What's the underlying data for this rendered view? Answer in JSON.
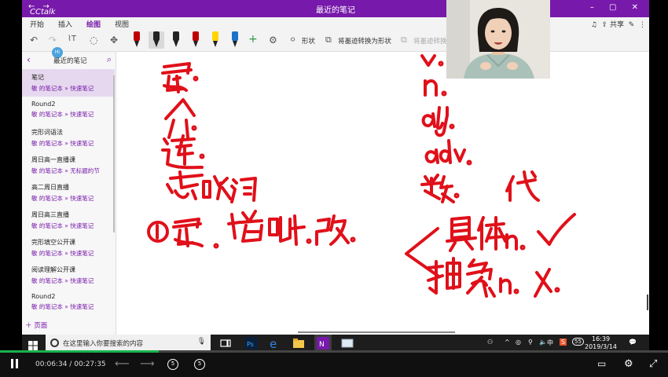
{
  "window": {
    "title": "最近的笔记",
    "app_brand": "CCtalk",
    "nav_back": "←",
    "nav_forward": "→",
    "win_controls": "–  ▢  ✕"
  },
  "menu": {
    "items": [
      "开始",
      "插入",
      "绘图",
      "视图"
    ],
    "active_index": 2,
    "share_label": "共享"
  },
  "toolbar": {
    "shape_label": "形状",
    "ink_to_shape_label": "将墨迹转换为形状",
    "ink_to_text_label": "将墨迹转换",
    "pen_colors": [
      "#c00000",
      "#222222",
      "#222222",
      "#c00000",
      "#ffd400",
      "#1a73c8"
    ],
    "selected_pen_index": 1
  },
  "sidebar": {
    "header": "最近的笔记",
    "avatar_text": "Hi Lv",
    "add_page": "页面",
    "pages": [
      {
        "title": "笔记",
        "path": "敏 的笔记本 » 快速笔记"
      },
      {
        "title": "Round2",
        "path": "敏 的笔记本 » 快速笔记"
      },
      {
        "title": "完形词语法",
        "path": "敏 的笔记本 » 快速笔记"
      },
      {
        "title": "周日高一直播课",
        "path": "敏 的笔记本 » 无标题的节"
      },
      {
        "title": "高二周日直播",
        "path": "敏 的笔记本 » 快速笔记"
      },
      {
        "title": "周日高三直播",
        "path": "敏 的笔记本 » 快速笔记"
      },
      {
        "title": "完形填空公开课",
        "path": "敏 的笔记本 » 快速笔记"
      },
      {
        "title": "阅读理解公开课",
        "path": "敏 的笔记本 » 快速笔记"
      },
      {
        "title": "Round2",
        "path": "敏 的笔记本 » 快速笔记"
      }
    ],
    "selected_index": 0
  },
  "ink": {
    "color": "#e0101a",
    "lines": [
      {
        "text": "冠.",
        "note": "handwritten"
      },
      {
        "text": "介.",
        "note": "handwritten"
      },
      {
        "text": "连.",
        "note": "handwritten"
      },
      {
        "text": "感叹词",
        "note": "handwritten"
      },
      {
        "text": "v.",
        "note": "handwritten"
      },
      {
        "text": "n.",
        "note": "handwritten"
      },
      {
        "text": "adj.",
        "note": "handwritten"
      },
      {
        "text": "adv.",
        "note": "handwritten"
      },
      {
        "text": "数.",
        "note": "handwritten"
      },
      {
        "text": "代",
        "note": "handwritten"
      },
      {
        "text": "①冠. 增.删.改.",
        "note": "handwritten"
      },
      {
        "text": "具体n. ✓",
        "note": "handwritten"
      },
      {
        "text": "抽象n. X",
        "note": "handwritten"
      }
    ]
  },
  "taskbar": {
    "search_placeholder": "在这里输入你要搜索的内容",
    "ime": "中",
    "badge": "55",
    "time": "16:39",
    "date": "2019/3/14"
  },
  "player": {
    "current_time": "00:06:34",
    "separator": "/",
    "total_time": "00:27:35",
    "progress": 0.238,
    "skip_back_label": "5",
    "skip_forward_label": "5"
  }
}
